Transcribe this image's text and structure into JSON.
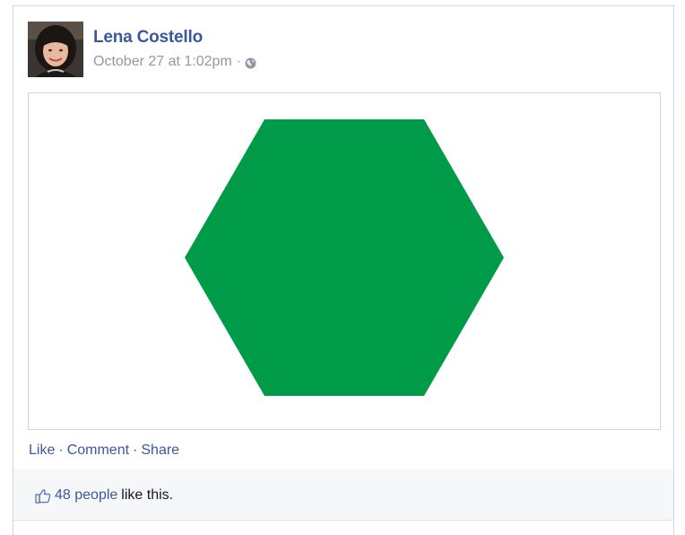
{
  "post": {
    "author": "Lena Costello",
    "timestamp": "October 27 at 1:02pm",
    "separator": "·",
    "privacy_icon": "globe-icon",
    "image_shape": "hexagon",
    "image_shape_color": "#009b48"
  },
  "actions": {
    "like": "Like",
    "comment": "Comment",
    "share": "Share",
    "dot": "·"
  },
  "likes": {
    "icon": "thumbs-up-icon",
    "count_text": "48 people",
    "suffix": "like this."
  },
  "colors": {
    "link_blue": "#3b5998",
    "meta_gray": "#9197a3",
    "likes_bar_bg": "#f6f7f9"
  }
}
